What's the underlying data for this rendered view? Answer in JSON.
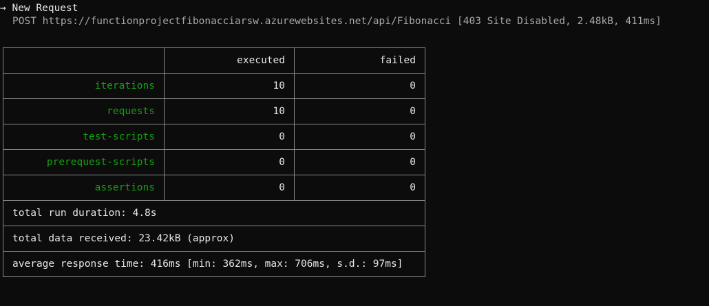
{
  "header": {
    "arrow": "→",
    "title": "New Request"
  },
  "request": {
    "text": "POST https://functionprojectfibonacciarsw.azurewebsites.net/api/Fibonacci [403 Site Disabled, 2.48kB, 411ms]"
  },
  "table": {
    "columns": [
      "",
      "executed",
      "failed"
    ],
    "rows": [
      {
        "label": "iterations",
        "executed": "10",
        "failed": "0"
      },
      {
        "label": "requests",
        "executed": "10",
        "failed": "0"
      },
      {
        "label": "test-scripts",
        "executed": "0",
        "failed": "0"
      },
      {
        "label": "prerequest-scripts",
        "executed": "0",
        "failed": "0"
      },
      {
        "label": "assertions",
        "executed": "0",
        "failed": "0"
      }
    ],
    "summary": [
      "total run duration: 4.8s",
      "total data received: 23.42kB (approx)",
      "average response time: 416ms [min: 362ms, max: 706ms, s.d.: 97ms]"
    ]
  },
  "colors": {
    "background": "#0c0c0c",
    "label_green": "#13a10e",
    "text": "#e6e6e6",
    "border": "#8a8a8a"
  }
}
